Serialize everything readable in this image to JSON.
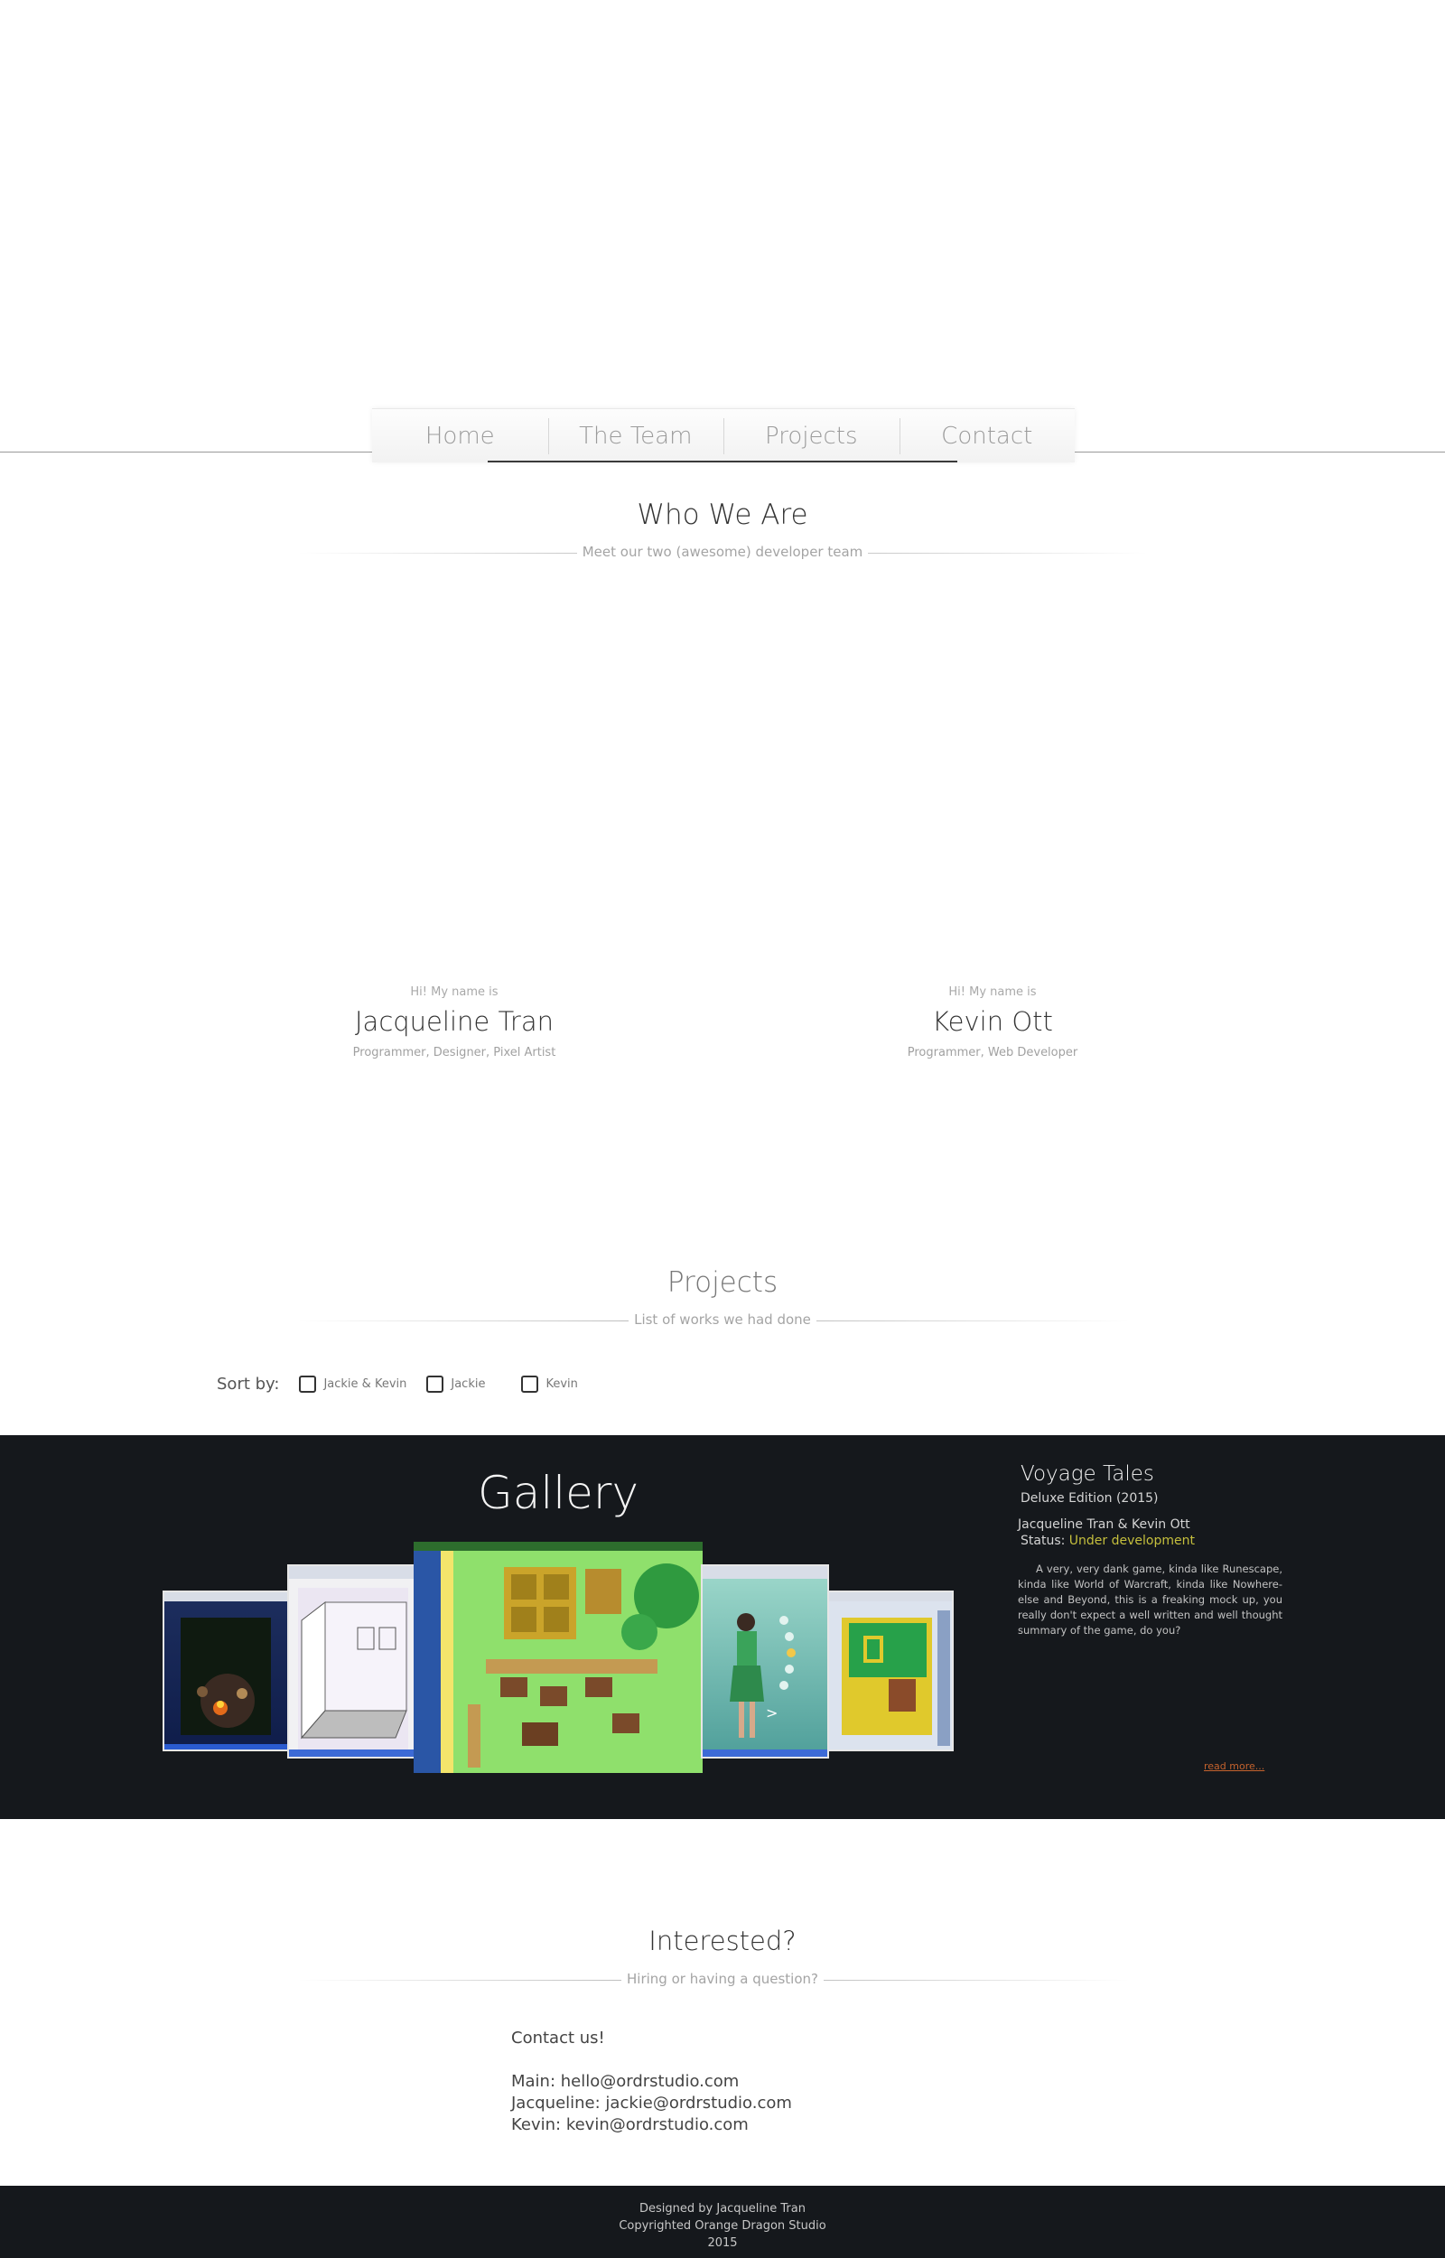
{
  "nav": {
    "items": [
      "Home",
      "The Team",
      "Projects",
      "Contact"
    ]
  },
  "team_section": {
    "title": "Who We Are",
    "subtitle": "Meet our two (awesome) developer team",
    "members": [
      {
        "greeting": "Hi! My name is",
        "name": "Jacqueline Tran",
        "role": "Programmer, Designer, Pixel Artist"
      },
      {
        "greeting": "Hi! My name is",
        "name": "Kevin Ott",
        "role": "Programmer, Web Developer"
      }
    ]
  },
  "projects_section": {
    "title": "Projects",
    "subtitle": "List of works we had done",
    "sort_label": "Sort by:",
    "filters": [
      {
        "label": "Jackie & Kevin",
        "checked": false
      },
      {
        "label": "Jackie",
        "checked": false
      },
      {
        "label": "Kevin",
        "checked": false
      }
    ]
  },
  "gallery": {
    "title": "Gallery",
    "project": {
      "title": "Voyage Tales",
      "edition": "Deluxe Edition (2015)",
      "authors": "Jacqueline Tran & Kevin Ott",
      "status_label": "Status:",
      "status_value": "Under development",
      "description": "A very, very dank game, kinda like Runescape, kinda like World of Warcraft, kinda like Nowhere-else and Beyond, this is a freaking mock up, you really don't expect a well written and well thought summary of the game, do you?",
      "read_more": "read more..."
    },
    "colors": {
      "background": "#15181c",
      "status": "#c5bf3d",
      "link": "#c4622d"
    }
  },
  "contact_section": {
    "title": "Interested?",
    "subtitle": "Hiring or having a question?",
    "intro": "Contact us!",
    "lines": [
      "Main: hello@ordrstudio.com",
      "Jacqueline: jackie@ordrstudio.com",
      "Kevin: kevin@ordrstudio.com"
    ]
  },
  "footer": {
    "lines": [
      "Designed by Jacqueline Tran",
      "Copyrighted Orange Dragon Studio",
      "2015"
    ]
  }
}
